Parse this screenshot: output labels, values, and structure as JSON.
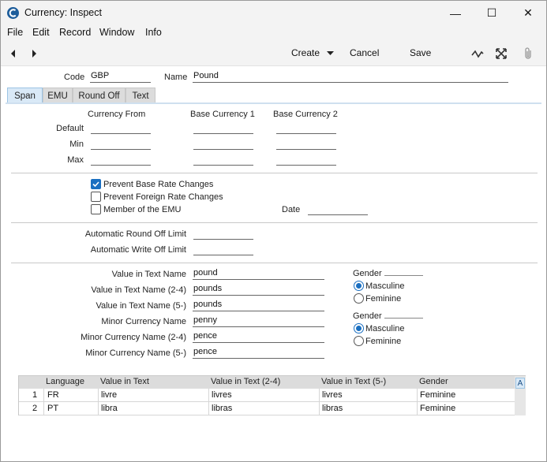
{
  "window": {
    "title": "Currency: Inspect",
    "controls": {
      "minimize": "—",
      "maximize": "☐",
      "close": "✕"
    }
  },
  "menu": [
    "File",
    "Edit",
    "Record",
    "Window",
    "Info"
  ],
  "toolbar": {
    "create_label": "Create",
    "cancel_label": "Cancel",
    "save_label": "Save"
  },
  "header": {
    "code_label": "Code",
    "code_value": "GBP",
    "name_label": "Name",
    "name_value": "Pound"
  },
  "tabs": [
    "Span",
    "EMU",
    "Round Off",
    "Text"
  ],
  "active_tab": "Span",
  "span": {
    "col_headers": [
      "Currency From",
      "Base Currency 1",
      "Base Currency 2"
    ],
    "row_labels": [
      "Default",
      "Min",
      "Max"
    ],
    "rows": [
      [
        "",
        "",
        ""
      ],
      [
        "",
        "",
        ""
      ],
      [
        "",
        "",
        ""
      ]
    ]
  },
  "checkboxes": [
    {
      "label": "Prevent Base Rate Changes",
      "checked": true
    },
    {
      "label": "Prevent Foreign Rate Changes",
      "checked": false
    },
    {
      "label": "Member of the EMU",
      "checked": false
    }
  ],
  "date": {
    "label": "Date",
    "value": ""
  },
  "round_off": {
    "auto_round_label": "Automatic Round Off Limit",
    "auto_round_value": "",
    "auto_write_label": "Automatic Write Off Limit",
    "auto_write_value": ""
  },
  "text_names": [
    {
      "label": "Value in Text Name",
      "value": "pound"
    },
    {
      "label": "Value in Text Name (2-4)",
      "value": "pounds"
    },
    {
      "label": "Value in Text Name (5-)",
      "value": "pounds"
    },
    {
      "label": "Minor Currency Name",
      "value": "penny"
    },
    {
      "label": "Minor Currency Name (2-4)",
      "value": "pence"
    },
    {
      "label": "Minor Currency Name (5-)",
      "value": "pence"
    }
  ],
  "gender_groups": [
    {
      "label": "Gender",
      "options": [
        "Masculine",
        "Feminine"
      ],
      "selected": "Masculine"
    },
    {
      "label": "Gender",
      "options": [
        "Masculine",
        "Feminine"
      ],
      "selected": "Masculine"
    }
  ],
  "language_grid": {
    "headers": [
      "Language",
      "Value in Text",
      "Value in Text (2-4)",
      "Value in Text (5-)",
      "Gender"
    ],
    "rows": [
      {
        "num": "1",
        "language": "FR",
        "v1": "livre",
        "v2": "livres",
        "v5": "livres",
        "gender": "Feminine"
      },
      {
        "num": "2",
        "language": "PT",
        "v1": "libra",
        "v2": "libras",
        "v5": "libras",
        "gender": "Feminine"
      }
    ],
    "side_button": "A"
  },
  "colors": {
    "accent": "#1a6fc1",
    "active_tab": "#d9e9f7"
  }
}
